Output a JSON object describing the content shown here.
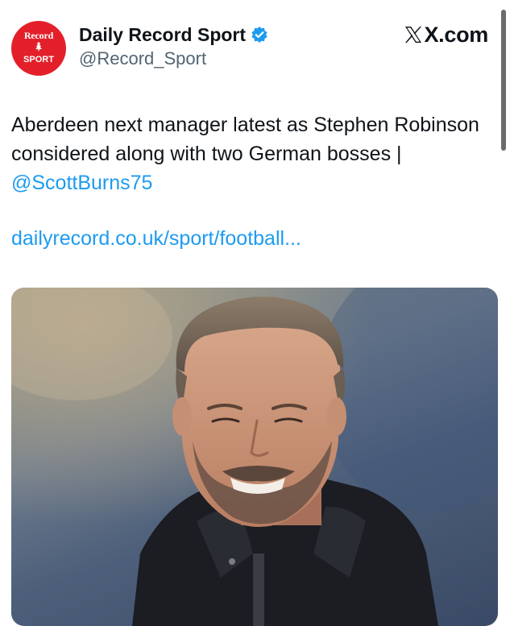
{
  "author": {
    "display_name": "Daily Record Sport",
    "handle": "@Record_Sport",
    "avatar_logo_top": "Record",
    "avatar_logo_bottom": "SPORT",
    "verified": true
  },
  "source": {
    "label": "X.com"
  },
  "tweet": {
    "text": "Aberdeen next manager latest as Stephen Robinson considered along with two German bosses | ",
    "mention": "@ScottBurns75",
    "link": "dailyrecord.co.uk/sport/football..."
  },
  "media": {
    "description_icon": "photo"
  },
  "colors": {
    "link_blue": "#1d9bf0",
    "brand_red": "#e3202a",
    "text_primary": "#0f1419",
    "text_secondary": "#536471"
  }
}
